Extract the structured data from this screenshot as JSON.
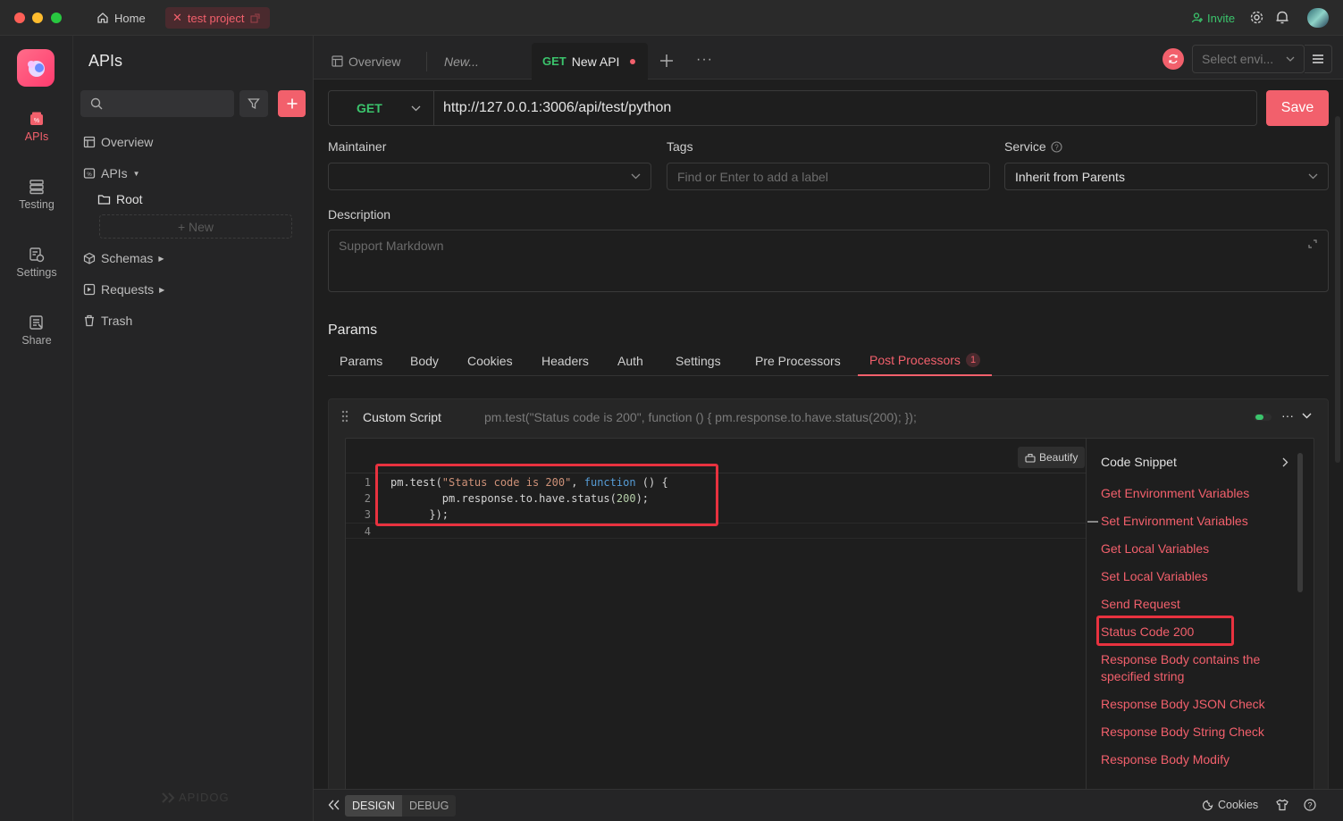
{
  "titlebar": {
    "home_label": "Home",
    "project_label": "test project",
    "invite_label": "Invite"
  },
  "rail": {
    "items": [
      {
        "label": "APIs",
        "icon": "apis-icon",
        "active": true
      },
      {
        "label": "Testing",
        "icon": "testing-icon",
        "active": false
      },
      {
        "label": "Settings",
        "icon": "settings-icon",
        "active": false
      },
      {
        "label": "Share",
        "icon": "share-icon",
        "active": false
      }
    ]
  },
  "sidebar": {
    "title": "APIs",
    "search_placeholder": "",
    "tree": {
      "overview": "Overview",
      "apis": "APIs",
      "root": "Root",
      "new": "+ New",
      "schemas": "Schemas",
      "requests": "Requests",
      "trash": "Trash"
    },
    "brand": "APIDOG"
  },
  "tabs": {
    "overview": "Overview",
    "new_tab": "New...",
    "active_method": "GET",
    "active_name": "New API",
    "env_placeholder": "Select envi..."
  },
  "request": {
    "method": "GET",
    "url": "http://127.0.0.1:3006/api/test/python",
    "save_label": "Save"
  },
  "fields": {
    "maintainer_label": "Maintainer",
    "maintainer_value": "",
    "tags_label": "Tags",
    "tags_placeholder": "Find or Enter to add a label",
    "service_label": "Service",
    "service_value": "Inherit from Parents",
    "description_label": "Description",
    "description_placeholder": "Support Markdown"
  },
  "params": {
    "title": "Params",
    "tabs": [
      "Params",
      "Body",
      "Cookies",
      "Headers",
      "Auth",
      "Settings",
      "Pre Processors",
      "Post Processors"
    ],
    "active_tab": "Post Processors",
    "active_badge": "1"
  },
  "script": {
    "title": "Custom Script",
    "preview": "pm.test(\"Status code is 200\", function () { pm.response.to.have.status(200); });",
    "beautify_label": "Beautify",
    "line_numbers": [
      "1",
      "2",
      "3",
      "4"
    ]
  },
  "snippets": {
    "title": "Code Snippet",
    "items": [
      "Get Environment Variables",
      "Set Environment Variables",
      "Get Local Variables",
      "Set Local Variables",
      "Send Request",
      "Status Code 200",
      "Response Body contains the specified string",
      "Response Body JSON Check",
      "Response Body String Check",
      "Response Body Modify"
    ]
  },
  "bottombar": {
    "design_label": "DESIGN",
    "debug_label": "DEBUG",
    "cookies_label": "Cookies"
  },
  "colors": {
    "accent": "#f2606c",
    "get_method": "#3bc46c",
    "highlight": "#e8323f"
  }
}
